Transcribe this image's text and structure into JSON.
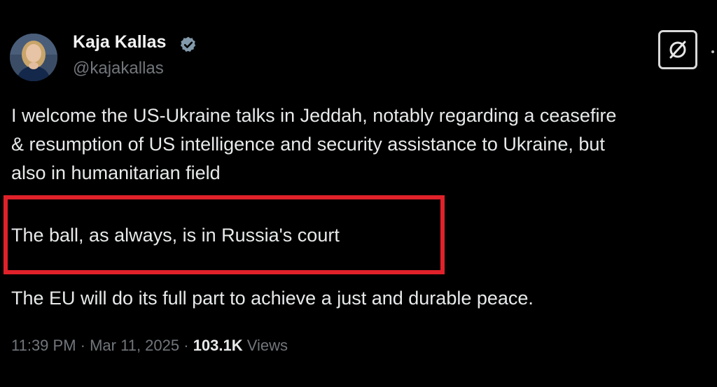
{
  "author": {
    "name": "Kaja Kallas",
    "handle": "@kajakallas",
    "verified": true,
    "avatar_icon": "profile-photo"
  },
  "tweet": {
    "paragraph_1": [
      "I welcome the US-Ukraine talks in Jeddah, notably regarding a ceasefire",
      "& resumption of US intelligence and security assistance to Ukraine, but",
      "also in humanitarian field"
    ],
    "paragraph_2": "The ball, as always, is in Russia's court",
    "paragraph_3": "The EU will do its full part to achieve a just and durable peace."
  },
  "meta": {
    "time": "11:39 PM",
    "separator": " · ",
    "date": "Mar 11, 2025",
    "views_count": "103.1K",
    "views_label": "Views"
  },
  "icons": {
    "verified": "verified-badge-icon",
    "grok": "grok-icon",
    "more": "more-options-icon"
  },
  "colors": {
    "background": "#000000",
    "text": "#e7e9ea",
    "muted": "#71767b",
    "highlight_border": "#e0212a",
    "verified_badge": "#829aab"
  }
}
